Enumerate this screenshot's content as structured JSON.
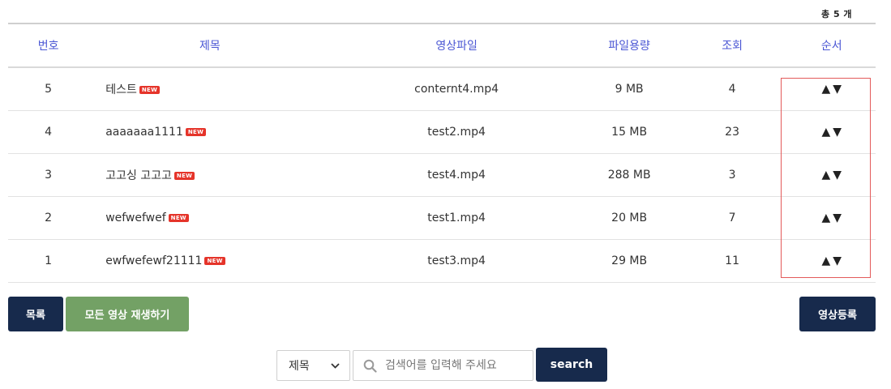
{
  "total_count": "총 5 개",
  "table": {
    "headers": {
      "num": "번호",
      "title": "제목",
      "file": "영상파일",
      "size": "파일용량",
      "views": "조회",
      "order": "순서"
    },
    "new_badge": "NEW",
    "rows": [
      {
        "num": "5",
        "title": "테스트",
        "file": "conternt4.mp4",
        "size": "9 MB",
        "views": "4"
      },
      {
        "num": "4",
        "title": "aaaaaaa1111",
        "file": "test2.mp4",
        "size": "15 MB",
        "views": "23"
      },
      {
        "num": "3",
        "title": "고고싱 고고고",
        "file": "test4.mp4",
        "size": "288 MB",
        "views": "3"
      },
      {
        "num": "2",
        "title": "wefwefwef",
        "file": "test1.mp4",
        "size": "20 MB",
        "views": "7"
      },
      {
        "num": "1",
        "title": "ewfwefewf21111",
        "file": "test3.mp4",
        "size": "29 MB",
        "views": "11"
      }
    ],
    "order_up": "▲",
    "order_down": "▼"
  },
  "buttons": {
    "list": "목록",
    "play_all": "모든 영상 재생하기",
    "register": "영상등록"
  },
  "search": {
    "field_selected": "제목",
    "placeholder": "검색어를 입력해 주세요",
    "button": "search"
  },
  "colors": {
    "header_text": "#4a56d4",
    "navy_button": "#172a4c",
    "green_button": "#73a165",
    "new_badge": "#e5342a",
    "highlight_border": "#e35a5a"
  },
  "icons": {
    "search": "magnifier-icon",
    "select": "chevron-down-icon",
    "order_up": "triangle-up-icon",
    "order_down": "triangle-down-icon"
  }
}
